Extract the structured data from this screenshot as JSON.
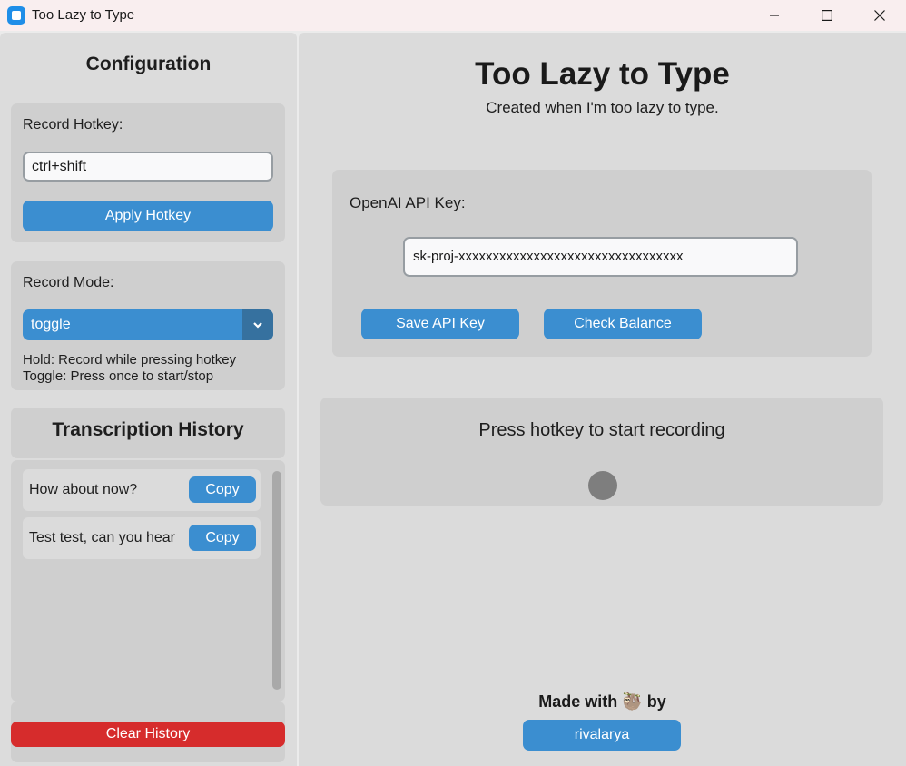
{
  "window": {
    "title": "Too Lazy to Type",
    "app_icon": "app-icon",
    "controls": [
      "minimize-icon",
      "maximize-icon",
      "close-icon"
    ]
  },
  "sidebar": {
    "title": "Configuration",
    "hotkey": {
      "label": "Record Hotkey:",
      "value": "ctrl+shift",
      "apply_label": "Apply Hotkey"
    },
    "mode": {
      "label": "Record Mode:",
      "selected": "toggle",
      "hint_hold": "Hold: Record while pressing hotkey",
      "hint_toggle": "Toggle: Press once to start/stop"
    },
    "history": {
      "title": "Transcription History",
      "items": [
        {
          "text": "How about now?",
          "copy_label": "Copy"
        },
        {
          "text": "Test test, can you hear",
          "copy_label": "Copy"
        }
      ],
      "clear_label": "Clear History"
    }
  },
  "main": {
    "title": "Too Lazy to Type",
    "subtitle": "Created when I'm too lazy to type.",
    "api": {
      "label": "OpenAI API Key:",
      "value": "sk-proj-xxxxxxxxxxxxxxxxxxxxxxxxxxxxxxxxx",
      "save_label": "Save API Key",
      "balance_label": "Check Balance"
    },
    "status": {
      "text": "Press hotkey to start recording",
      "indicator_color": "#7e7e7e"
    },
    "footer": {
      "made_with": "Made with 🦥 by",
      "author": "rivalarya"
    }
  },
  "colors": {
    "accent": "#3b8ed0",
    "accent_dark": "#36719f",
    "danger": "#d62c2c"
  }
}
